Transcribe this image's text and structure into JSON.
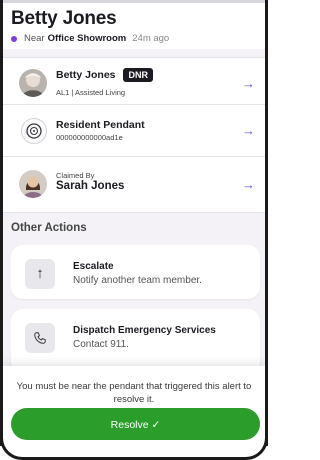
{
  "header": {
    "title": "Betty Jones",
    "location_prefix": "Near",
    "location_name": "Office Showroom",
    "time_ago": "24m ago"
  },
  "resident": {
    "name": "Betty Jones",
    "badge": "DNR",
    "detail": "AL1 | Assisted Living"
  },
  "pendant": {
    "title": "Resident Pendant",
    "id": "000000000000ad1e"
  },
  "claimed": {
    "label": "Claimed By",
    "name": "Sarah Jones"
  },
  "other_actions": {
    "title": "Other Actions",
    "items": [
      {
        "title": "Escalate",
        "subtitle": "Notify another team member.",
        "icon": "arrow-up-icon"
      },
      {
        "title": "Dispatch Emergency Services",
        "subtitle": "Contact 911.",
        "icon": "phone-icon"
      }
    ]
  },
  "footer": {
    "message": "You must be near the pendant that triggered this alert to resolve it.",
    "resolve_label": "Resolve ✓"
  },
  "colors": {
    "accent": "#6b4de6",
    "location_dot": "#7a3ee0",
    "resolve": "#2a9d2a",
    "badge_bg": "#1c1b22"
  }
}
